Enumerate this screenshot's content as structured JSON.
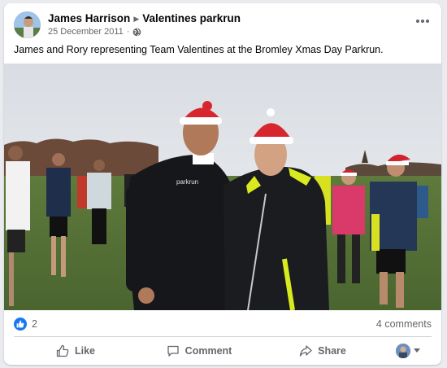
{
  "post": {
    "author": "James Harrison",
    "group": "Valentines parkrun",
    "date": "25 December 2011",
    "caption": "James and Rory representing Team Valentines at the Bromley Xmas Day Parkrun.",
    "photo_description": "Two runners in black jackets and Santa hats posing in a park with other parkrun participants"
  },
  "icons": {
    "arrow": "triangle-right-icon",
    "audience": "globe-icon",
    "menu": "more-horizontal-icon",
    "reaction": "like-reaction-icon"
  },
  "stats": {
    "reaction_count": "2",
    "comments": "4 comments"
  },
  "actions": {
    "like": "Like",
    "comment": "Comment",
    "share": "Share"
  },
  "colors": {
    "accent": "#1877f2",
    "secondary_text": "#65676b"
  }
}
